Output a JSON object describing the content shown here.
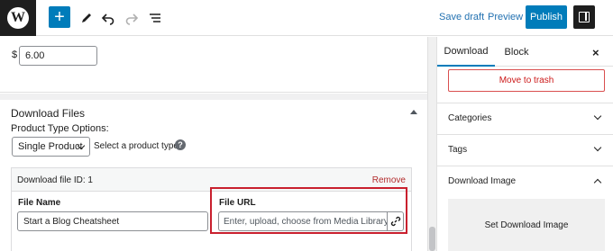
{
  "toolbar": {
    "save_draft": "Save draft",
    "preview": "Preview",
    "publish": "Publish",
    "add_icon": "+"
  },
  "price": {
    "currency": "$",
    "value": "6.00"
  },
  "download_files": {
    "title": "Download Files",
    "product_type_label": "Product Type Options:",
    "product_type_selected": "Single Product",
    "product_type_hint": "Select a product type",
    "file": {
      "id_label": "Download file ID: 1",
      "remove": "Remove",
      "name_label": "File Name",
      "name_value": "Start a Blog Cheatsheet",
      "url_label": "File URL",
      "url_placeholder": "Enter, upload, choose from Media Library"
    }
  },
  "sidebar": {
    "tabs": [
      "Download",
      "Block"
    ],
    "close": "×",
    "move_to_trash": "Move to trash",
    "sections": [
      {
        "label": "Categories",
        "open": false
      },
      {
        "label": "Tags",
        "open": false
      },
      {
        "label": "Download Image",
        "open": true
      }
    ],
    "set_image": "Set Download Image"
  },
  "colors": {
    "accent": "#007cba",
    "danger": "#cc1818",
    "highlight": "#c9202e"
  }
}
